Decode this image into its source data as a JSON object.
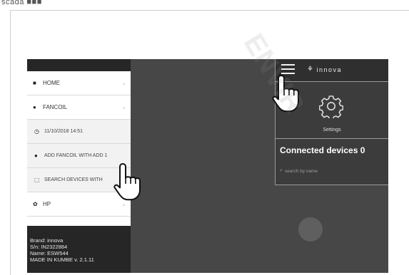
{
  "caption": "scada ■■■",
  "sidebar": {
    "items": [
      {
        "icon": "house-icon",
        "glyph": "■",
        "label": "HOME"
      },
      {
        "icon": "device-icon",
        "glyph": "●",
        "label": "FANCOIL"
      }
    ],
    "subitems": [
      {
        "icon": "clock-icon",
        "glyph": "◷",
        "label": "11/10/2018 14:51"
      },
      {
        "icon": "add-icon",
        "glyph": "●",
        "label": "ADD FANCOIL WITH ADD 1"
      },
      {
        "icon": "search-devices-icon",
        "glyph": "⬚",
        "label": "SEARCH DEVICES WITH"
      }
    ],
    "hp": {
      "icon": "gear-icon",
      "glyph": "✿",
      "label": "HP"
    },
    "chevron": "›",
    "footer": {
      "brand": "Brand: innova",
      "sn": "S/n: IN2322884",
      "name": "Name: ESW544",
      "made": "MADE IN KUMBE v. 2.1.11"
    }
  },
  "panel": {
    "logo_mark": "⚘",
    "logo_text": "innova",
    "settings_label": "Settings",
    "connected": "Connected devices 0",
    "search_icon": "⌕",
    "search_placeholder": "search by name"
  },
  "watermark": "ENVIR"
}
